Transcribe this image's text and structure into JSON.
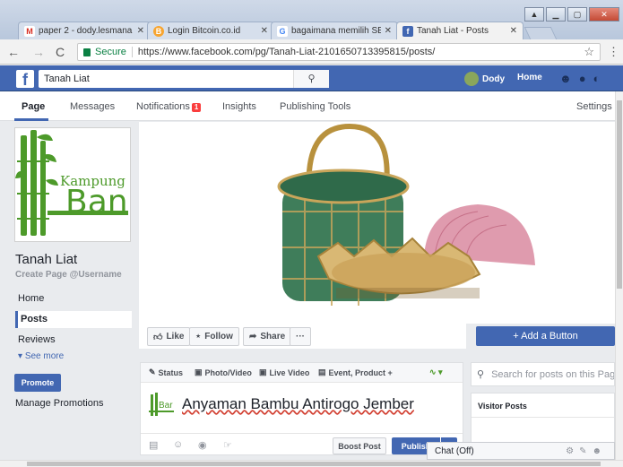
{
  "browser": {
    "tabs": [
      {
        "title": "paper 2 - dody.lesmana",
        "favicon": "M"
      },
      {
        "title": "Login Bitcoin.co.id",
        "favicon": "B"
      },
      {
        "title": "bagaimana memilih SEO",
        "favicon": "G"
      },
      {
        "title": "Tanah Liat - Posts",
        "favicon": "f"
      }
    ],
    "secure_label": "Secure",
    "url": "https://www.facebook.com/pg/Tanah-Liat-2101650713395815/posts/"
  },
  "fb_header": {
    "search_value": "Tanah Liat",
    "user_name": "Dody",
    "home_label": "Home"
  },
  "page_nav": {
    "page": "Page",
    "messages": "Messages",
    "notifications": "Notifications",
    "notifications_count": "1",
    "insights": "Insights",
    "publishing_tools": "Publishing Tools",
    "settings": "Settings"
  },
  "profile": {
    "logo_text_top": "Kampung",
    "logo_text_big": "Ban",
    "page_name": "Tanah Liat",
    "username_link": "Create Page @Username"
  },
  "left_nav": {
    "home": "Home",
    "posts": "Posts",
    "reviews": "Reviews",
    "see_more": "See more",
    "promote": "Promote",
    "manage_promotions": "Manage Promotions"
  },
  "actions": {
    "like": "Like",
    "follow": "Follow",
    "share": "Share",
    "more": "···",
    "add_button": "+ Add a Button"
  },
  "composer": {
    "tabs": [
      "Status",
      "Photo/Video",
      "Live Video",
      "Event, Product +"
    ],
    "text": "Anyaman Bambu Antirogo Jember",
    "logo_text": "Bar",
    "boost": "Boost Post",
    "publish": "Publish"
  },
  "right": {
    "search_placeholder": "Search for posts on this Page",
    "visitor_posts": "Visitor Posts",
    "chat": "Chat (Off)"
  },
  "colors": {
    "facebook_blue": "#4267b2",
    "background": "#e9ebee",
    "notification_red": "#fa3e3e"
  }
}
